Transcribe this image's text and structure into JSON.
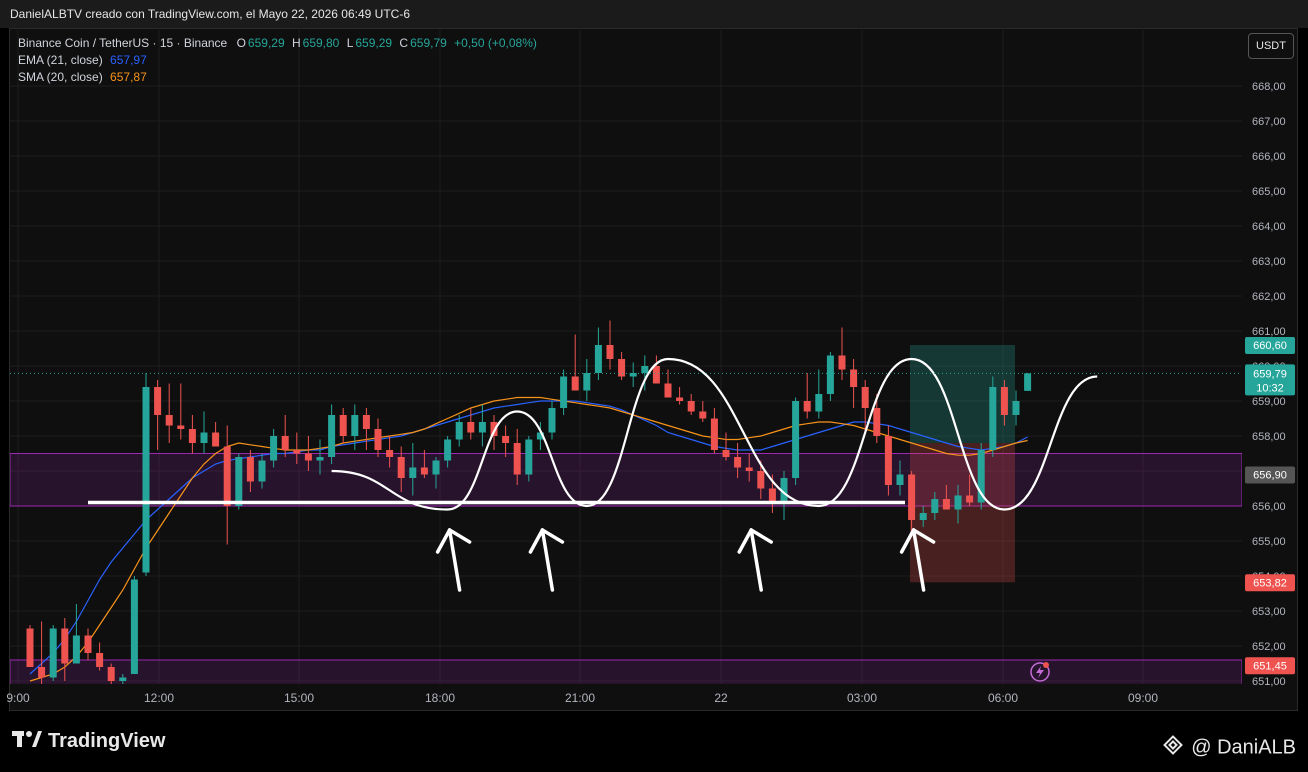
{
  "header": {
    "caption": "DanielALBTV creado con TradingView.com, el Mayo 22, 2026 06:49 UTC-6"
  },
  "legend": {
    "symbol": "Binance Coin / TetherUS · 15 · Binance",
    "o_label": "O",
    "o_value": "659,29",
    "h_label": "H",
    "h_value": "659,80",
    "l_label": "L",
    "l_value": "659,29",
    "c_label": "C",
    "c_value": "659,79",
    "change": "+0,50 (+0,08%)",
    "ema_label": "EMA (21, close)",
    "ema_value": "657,97",
    "sma_label": "SMA (20, close)",
    "sma_value": "657,87"
  },
  "currency_button": "USDT",
  "footer": {
    "brand": "TradingView",
    "user": "@ DaniALB"
  },
  "colors": {
    "up": "#26a69a",
    "down": "#ef5350",
    "ema": "#2962ff",
    "sma": "#f7931a",
    "zone": "#9c27b0",
    "bg": "#0f0f0f"
  },
  "chart_data": {
    "type": "candlestick",
    "ylim": [
      651.0,
      669.0
    ],
    "y_ticks": [
      "668,00",
      "667,00",
      "666,00",
      "665,00",
      "664,00",
      "663,00",
      "662,00",
      "661,00",
      "660,00",
      "659,00",
      "658,00",
      "657,00",
      "656,00",
      "655,00",
      "654,00",
      "653,00",
      "652,00",
      "651,00"
    ],
    "x_ticks": [
      "9:00",
      "12:00",
      "15:00",
      "18:00",
      "21:00",
      "22",
      "03:00",
      "06:00",
      "09:00"
    ],
    "last_price": 659.79,
    "last_price_label": "659,79",
    "countdown": "10:32",
    "price_tags": [
      {
        "label": "660,60",
        "value": 660.6,
        "color": "#26a69a"
      },
      {
        "label": "656,90",
        "value": 656.9,
        "color": "#555555"
      },
      {
        "label": "653,82",
        "value": 653.82,
        "color": "#ef5350"
      },
      {
        "label": "651,45",
        "value": 651.45,
        "color": "#ef5350"
      }
    ],
    "zones": [
      {
        "from": 656.0,
        "to": 657.5
      },
      {
        "from": 650.8,
        "to": 651.6
      }
    ],
    "support_level": 656.1,
    "position_box": {
      "entry": 657.8,
      "target": 660.6,
      "stop": 653.82,
      "start_bar": 66,
      "end_bar": 71
    },
    "candles": [
      [
        652.5,
        652.6,
        651.8,
        651.4
      ],
      [
        651.4,
        652.7,
        650.9,
        651.1
      ],
      [
        651.1,
        652.6,
        651.0,
        652.5
      ],
      [
        652.5,
        652.8,
        651.0,
        651.5
      ],
      [
        651.5,
        653.2,
        651.5,
        652.3
      ],
      [
        652.3,
        652.5,
        651.6,
        651.8
      ],
      [
        651.8,
        652.1,
        651.3,
        651.4
      ],
      [
        651.4,
        651.5,
        650.8,
        651.0
      ],
      [
        651.0,
        651.2,
        650.8,
        651.1
      ],
      [
        651.2,
        654.0,
        651.2,
        653.9
      ],
      [
        654.1,
        659.8,
        654.0,
        659.4
      ],
      [
        659.4,
        659.6,
        657.6,
        658.6
      ],
      [
        658.6,
        659.5,
        657.8,
        658.3
      ],
      [
        658.3,
        659.5,
        657.9,
        658.2
      ],
      [
        658.2,
        658.6,
        657.5,
        657.8
      ],
      [
        657.8,
        658.7,
        657.5,
        658.1
      ],
      [
        658.1,
        658.4,
        657.8,
        657.7
      ],
      [
        657.7,
        658.3,
        654.9,
        656.0
      ],
      [
        656.0,
        657.5,
        655.9,
        657.4
      ],
      [
        657.4,
        657.6,
        656.4,
        656.7
      ],
      [
        656.7,
        657.5,
        656.5,
        657.3
      ],
      [
        657.3,
        658.2,
        657.1,
        658.0
      ],
      [
        658.0,
        658.6,
        657.4,
        657.6
      ],
      [
        657.6,
        658.1,
        657.2,
        657.5
      ],
      [
        657.5,
        658.0,
        657.0,
        657.3
      ],
      [
        657.3,
        657.9,
        656.9,
        657.4
      ],
      [
        657.4,
        658.9,
        657.2,
        658.6
      ],
      [
        658.6,
        658.8,
        657.8,
        658.0
      ],
      [
        658.0,
        658.9,
        657.6,
        658.6
      ],
      [
        658.6,
        658.8,
        657.6,
        658.2
      ],
      [
        658.2,
        658.5,
        657.4,
        657.6
      ],
      [
        657.6,
        658.0,
        657.1,
        657.4
      ],
      [
        657.4,
        657.7,
        656.4,
        656.8
      ],
      [
        656.8,
        657.8,
        656.3,
        657.1
      ],
      [
        657.1,
        657.6,
        656.8,
        656.9
      ],
      [
        656.9,
        657.4,
        656.5,
        657.3
      ],
      [
        657.3,
        658.0,
        657.1,
        657.9
      ],
      [
        657.9,
        658.6,
        657.7,
        658.4
      ],
      [
        658.4,
        658.8,
        657.9,
        658.1
      ],
      [
        658.1,
        658.9,
        657.7,
        658.4
      ],
      [
        658.4,
        658.6,
        657.6,
        658.0
      ],
      [
        658.0,
        658.3,
        657.4,
        657.8
      ],
      [
        657.8,
        658.2,
        656.6,
        656.9
      ],
      [
        656.9,
        658.0,
        656.7,
        657.9
      ],
      [
        657.9,
        658.4,
        657.6,
        658.1
      ],
      [
        658.1,
        659.0,
        657.9,
        658.8
      ],
      [
        658.8,
        659.9,
        658.6,
        659.7
      ],
      [
        659.7,
        660.9,
        659.3,
        659.3
      ],
      [
        659.3,
        660.2,
        659.0,
        659.8
      ],
      [
        659.8,
        661.1,
        659.6,
        660.6
      ],
      [
        660.6,
        661.3,
        659.9,
        660.2
      ],
      [
        660.2,
        660.4,
        659.6,
        659.7
      ],
      [
        659.7,
        660.1,
        659.4,
        659.8
      ],
      [
        659.8,
        660.3,
        659.3,
        660.0
      ],
      [
        660.0,
        660.3,
        659.6,
        659.5
      ],
      [
        659.5,
        659.9,
        659.2,
        659.1
      ],
      [
        659.1,
        659.4,
        658.9,
        659.0
      ],
      [
        659.0,
        659.2,
        658.6,
        658.7
      ],
      [
        658.7,
        659.0,
        658.4,
        658.5
      ],
      [
        658.5,
        658.8,
        657.5,
        657.6
      ],
      [
        657.6,
        658.1,
        657.3,
        657.4
      ],
      [
        657.4,
        657.8,
        656.8,
        657.1
      ],
      [
        657.1,
        657.5,
        656.7,
        657.0
      ],
      [
        657.0,
        657.3,
        656.2,
        656.5
      ],
      [
        656.5,
        656.9,
        655.8,
        656.1
      ],
      [
        656.1,
        657.0,
        655.6,
        656.8
      ],
      [
        656.8,
        659.1,
        656.6,
        659.0
      ],
      [
        659.0,
        659.8,
        658.5,
        658.7
      ],
      [
        658.7,
        659.9,
        658.5,
        659.2
      ],
      [
        659.2,
        660.4,
        659.0,
        660.3
      ],
      [
        660.3,
        661.1,
        659.6,
        659.9
      ],
      [
        659.9,
        660.2,
        658.8,
        659.4
      ],
      [
        659.4,
        659.6,
        658.1,
        658.8
      ],
      [
        658.8,
        659.2,
        657.8,
        658.0
      ],
      [
        658.0,
        658.3,
        656.3,
        656.6
      ],
      [
        656.6,
        657.3,
        656.3,
        656.9
      ],
      [
        656.9,
        657.0,
        655.3,
        655.6
      ],
      [
        655.6,
        656.0,
        655.4,
        655.8
      ],
      [
        655.8,
        656.4,
        655.6,
        656.2
      ],
      [
        656.2,
        656.6,
        655.9,
        655.9
      ],
      [
        655.9,
        656.6,
        655.5,
        656.3
      ],
      [
        656.3,
        656.9,
        656.0,
        656.1
      ],
      [
        656.1,
        657.8,
        655.9,
        657.6
      ],
      [
        657.6,
        659.7,
        657.4,
        659.4
      ],
      [
        659.4,
        659.6,
        658.3,
        658.6
      ],
      [
        658.6,
        659.3,
        658.3,
        659.0
      ],
      [
        659.29,
        659.8,
        659.29,
        659.79
      ]
    ],
    "ema": [
      651.2,
      651.5,
      651.8,
      652.2,
      652.7,
      653.3,
      653.9,
      654.4,
      654.8,
      655.2,
      655.6,
      655.9,
      656.2,
      656.5,
      656.8,
      657.0,
      657.2,
      657.3,
      657.35,
      657.4,
      657.45,
      657.5,
      657.5,
      657.55,
      657.6,
      657.6,
      657.7,
      657.75,
      657.8,
      657.85,
      657.9,
      657.95,
      658.0,
      658.1,
      658.2,
      658.3,
      658.4,
      658.5,
      658.6,
      658.7,
      658.8,
      658.85,
      658.9,
      658.95,
      659.0,
      659.0,
      659.0,
      659.0,
      658.95,
      658.9,
      658.85,
      658.75,
      658.6,
      658.45,
      658.3,
      658.1,
      658.0,
      657.9,
      657.8,
      657.7,
      657.65,
      657.6,
      657.6,
      657.6,
      657.7,
      657.8,
      657.9,
      658.0,
      658.1,
      658.2,
      658.3,
      658.4,
      658.4,
      658.35,
      658.3,
      658.2,
      658.1,
      658.0,
      657.9,
      657.8,
      657.7,
      657.65,
      657.6,
      657.65,
      657.7,
      657.8,
      657.97
    ],
    "sma": [
      651.0,
      651.1,
      651.2,
      651.4,
      651.7,
      652.1,
      652.6,
      653.1,
      653.6,
      654.2,
      654.8,
      655.3,
      655.8,
      656.3,
      656.8,
      657.2,
      657.5,
      657.7,
      657.8,
      657.75,
      657.7,
      657.65,
      657.6,
      657.6,
      657.6,
      657.65,
      657.7,
      657.8,
      657.85,
      657.9,
      657.95,
      658.0,
      658.05,
      658.1,
      658.2,
      658.35,
      658.5,
      658.65,
      658.8,
      658.9,
      659.0,
      659.05,
      659.1,
      659.1,
      659.1,
      659.05,
      659.0,
      658.95,
      658.9,
      658.85,
      658.8,
      658.7,
      658.6,
      658.5,
      658.4,
      658.3,
      658.2,
      658.1,
      658.0,
      657.95,
      657.9,
      657.9,
      657.95,
      658.0,
      658.1,
      658.2,
      658.3,
      658.35,
      658.4,
      658.4,
      658.35,
      658.3,
      658.2,
      658.1,
      658.0,
      657.9,
      657.8,
      657.7,
      657.6,
      657.5,
      657.45,
      657.45,
      657.5,
      657.6,
      657.7,
      657.8,
      657.87
    ],
    "zigzag": [
      [
        26,
        657.0
      ],
      [
        36,
        655.9
      ],
      [
        42,
        658.7
      ],
      [
        48,
        656.0
      ],
      [
        55,
        660.2
      ],
      [
        68,
        656.0
      ],
      [
        76,
        660.2
      ],
      [
        84,
        655.9
      ],
      [
        92,
        659.7
      ]
    ],
    "arrows": [
      [
        36,
        655.6
      ],
      [
        44,
        655.6
      ],
      [
        62,
        655.6
      ],
      [
        76,
        655.6
      ]
    ]
  }
}
